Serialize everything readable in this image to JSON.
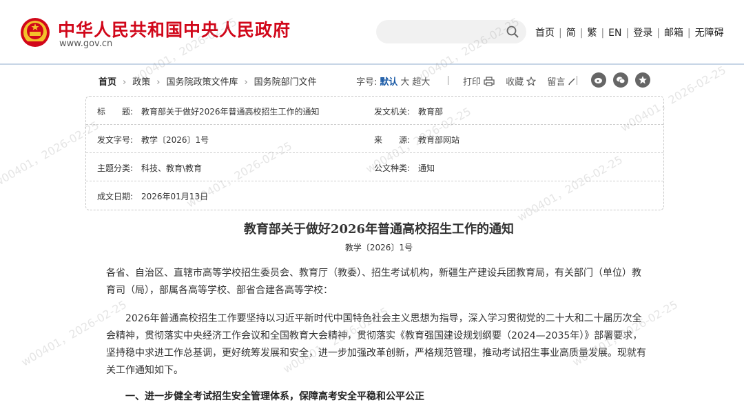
{
  "header": {
    "site_title": "中华人民共和国中央人民政府",
    "site_url": "www.gov.cn",
    "nav": [
      "首页",
      "简",
      "繁",
      "EN",
      "登录",
      "邮箱",
      "无障碍"
    ]
  },
  "breadcrumb": {
    "items": [
      "首页",
      "政策",
      "国务院政策文件库",
      "国务院部门文件"
    ]
  },
  "font_size": {
    "label": "字号:",
    "options": [
      "默认",
      "大",
      "超大"
    ],
    "selected": "默认"
  },
  "tools": {
    "print": "打印",
    "favorite": "收藏",
    "comment": "留言"
  },
  "info": {
    "title_label": "标　　题:",
    "title_value": "教育部关于做好2026年普通高校招生工作的通知",
    "issuer_label": "发文机关:",
    "issuer_value": "教育部",
    "docno_label": "发文字号:",
    "docno_value": "教学〔2026〕1号",
    "source_label": "来　　源:",
    "source_value": "教育部网站",
    "topic_label": "主题分类:",
    "topic_value": "科技、教育\\教育",
    "type_label": "公文种类:",
    "type_value": "通知",
    "date_label": "成文日期:",
    "date_value": "2026年01月13日"
  },
  "article": {
    "title": "教育部关于做好2026年普通高校招生工作的通知",
    "doc_no": "教学〔2026〕1号",
    "paragraph1": "各省、自治区、直辖市高等学校招生委员会、教育厅（教委）、招生考试机构，新疆生产建设兵团教育局，有关部门（单位）教育司（局），部属各高等学校、部省合建各高等学校：",
    "paragraph2": "2026年普通高校招生工作要坚持以习近平新时代中国特色社会主义思想为指导，深入学习贯彻党的二十大和二十届历次全会精神，贯彻落实中央经济工作会议和全国教育大会精神，贯彻落实《教育强国建设规划纲要（2024—2035年）》部署要求，坚持稳中求进工作总基调，更好统筹发展和安全，进一步加强改革创新，严格规范管理，推动考试招生事业高质量发展。现就有关工作通知如下。",
    "heading1": "一、进一步健全考试招生安全管理体系，保障高考安全平稳和公平公正"
  },
  "watermark": "w00401，2026-02-25",
  "colors": {
    "brand_red": "#d1071a",
    "link_blue": "#1a5aa6"
  }
}
